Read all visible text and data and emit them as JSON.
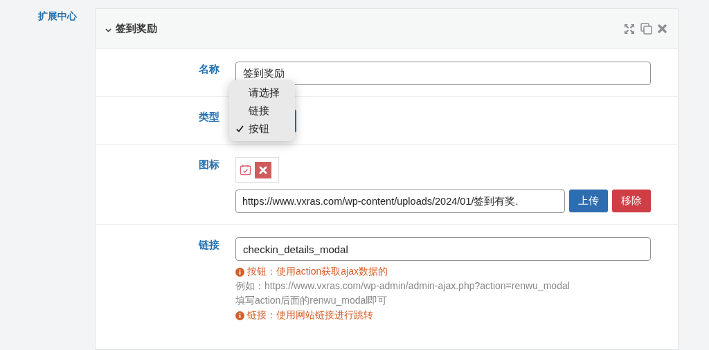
{
  "section_label": "扩展中心",
  "panel": {
    "title": "签到奖励",
    "expanded": true
  },
  "fields": [
    {
      "kind": "text",
      "label": "名称",
      "value": "签到奖励"
    },
    {
      "kind": "select",
      "label": "类型",
      "options": [
        {
          "label": "请选择",
          "selected": false
        },
        {
          "label": "链接",
          "selected": false
        },
        {
          "label": "按钮",
          "selected": true
        }
      ]
    },
    {
      "kind": "image",
      "label": "图标",
      "value": "https://www.vxras.com/wp-content/uploads/2024/01/签到有奖.",
      "buttons": [
        {
          "label": "上传",
          "kind": "primary"
        },
        {
          "label": "移除",
          "kind": "danger"
        }
      ]
    },
    {
      "kind": "text",
      "label": "链接",
      "value": "checkin_details_modal",
      "help": [
        {
          "kind": "info",
          "text": "按钮：使用action获取ajax数据的"
        },
        {
          "kind": "note",
          "text": "例如：https://www.vxras.com/wp-admin/admin-ajax.php?action=renwu_modal"
        },
        {
          "kind": "note",
          "text": "填写action后面的renwu_modal即可"
        },
        {
          "kind": "info",
          "text": "链接：使用网站链接进行跳转"
        }
      ]
    }
  ]
}
